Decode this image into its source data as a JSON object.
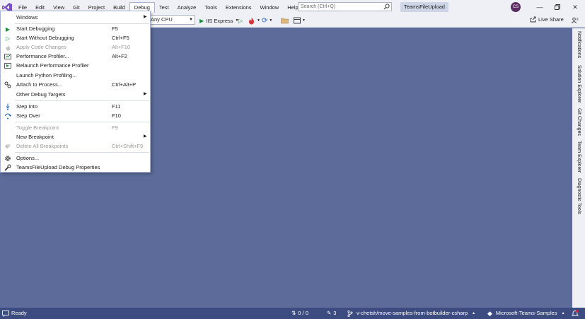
{
  "menubar": {
    "items": [
      "File",
      "Edit",
      "View",
      "Git",
      "Project",
      "Build",
      "Debug",
      "Test",
      "Analyze",
      "Tools",
      "Extensions",
      "Window",
      "Help"
    ],
    "active": "Debug"
  },
  "search": {
    "placeholder": "Search (Ctrl+Q)"
  },
  "solution_name": "TeamsFileUpload",
  "avatar_initials": "CS",
  "toolbar": {
    "platform": "Any CPU",
    "run_target": "IIS Express",
    "live_share": "Live Share"
  },
  "debug_menu": {
    "windows": "Windows",
    "start_debugging": {
      "label": "Start Debugging",
      "shortcut": "F5"
    },
    "start_without": {
      "label": "Start Without Debugging",
      "shortcut": "Ctrl+F5"
    },
    "apply_code": {
      "label": "Apply Code Changes",
      "shortcut": "Alt+F10"
    },
    "perf_profiler": {
      "label": "Performance Profiler...",
      "shortcut": "Alt+F2"
    },
    "relaunch_perf": "Relaunch Performance Profiler",
    "launch_python": "Launch Python Profiling...",
    "attach": {
      "label": "Attach to Process...",
      "shortcut": "Ctrl+Alt+P"
    },
    "other_targets": "Other Debug Targets",
    "step_into": {
      "label": "Step Into",
      "shortcut": "F11"
    },
    "step_over": {
      "label": "Step Over",
      "shortcut": "F10"
    },
    "toggle_bp": {
      "label": "Toggle Breakpoint",
      "shortcut": "F9"
    },
    "new_bp": "New Breakpoint",
    "delete_bp": {
      "label": "Delete All Breakpoints",
      "shortcut": "Ctrl+Shift+F9"
    },
    "options": "Options...",
    "debug_props": "TeamsFileUpload Debug Properties"
  },
  "side_tabs": [
    "Notifications",
    "Solution Explorer",
    "Git Changes",
    "Team Explorer",
    "Diagnostic Tools"
  ],
  "status": {
    "ready": "Ready",
    "changes": "0 / 0",
    "pencil_count": "3",
    "branch": "v-chetsh/move-samples-from-botbuilder-csharp",
    "repo": "Microsoft-Teams-Samples"
  },
  "colors": {
    "workspace": "#5c6b99",
    "statusbar": "#3c4b80",
    "chrome": "#eef0f5",
    "accent_run": "#1e8a3c",
    "vs_purple": "#7b4ec9"
  }
}
